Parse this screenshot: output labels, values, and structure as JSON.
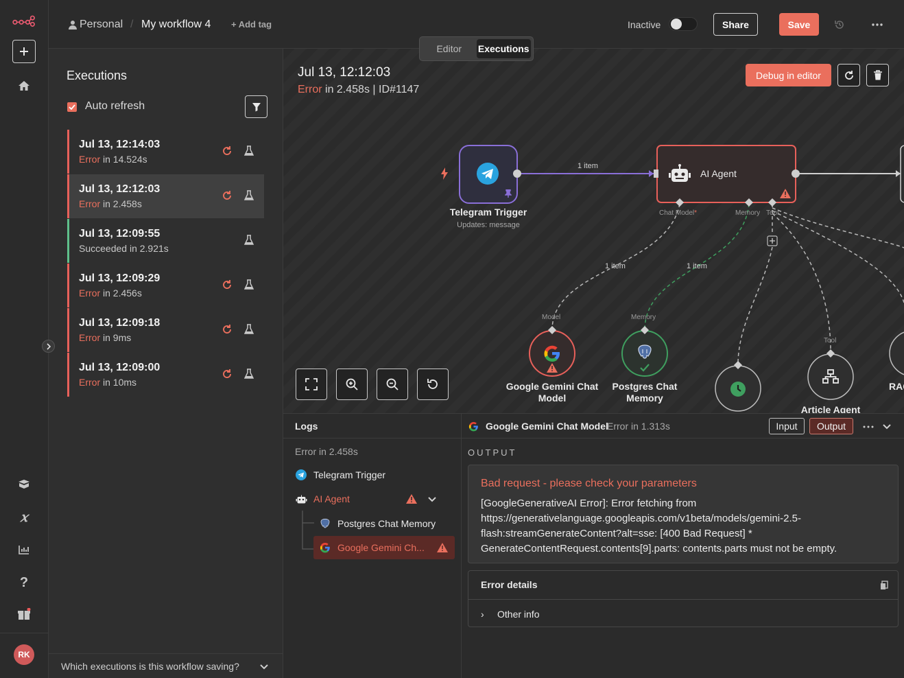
{
  "header": {
    "project": "Personal",
    "workflow_name": "My workflow 4",
    "add_tag": "+ Add tag",
    "active_label": "Inactive",
    "share": "Share",
    "save": "Save"
  },
  "mode_switch": {
    "editor": "Editor",
    "executions": "Executions"
  },
  "sidebar": {
    "avatar_initials": "RK"
  },
  "executions": {
    "title": "Executions",
    "auto_refresh": "Auto refresh",
    "items": [
      {
        "time": "Jul 13, 12:14:03",
        "status": "Error",
        "detail": " in 14.524s",
        "retry": true
      },
      {
        "time": "Jul 13, 12:12:03",
        "status": "Error",
        "detail": " in 2.458s",
        "retry": true
      },
      {
        "time": "Jul 13, 12:09:55",
        "status": "Succeeded",
        "detail": " in 2.921s",
        "retry": false
      },
      {
        "time": "Jul 13, 12:09:29",
        "status": "Error",
        "detail": " in 2.456s",
        "retry": true
      },
      {
        "time": "Jul 13, 12:09:18",
        "status": "Error",
        "detail": " in 9ms",
        "retry": true
      },
      {
        "time": "Jul 13, 12:09:00",
        "status": "Error",
        "detail": " in 10ms",
        "retry": true
      }
    ],
    "saving_question": "Which executions is this workflow saving?"
  },
  "canvas": {
    "run_time": "Jul 13, 12:12:03",
    "run_status": "Error",
    "run_detail": " in 2.458s",
    "run_id": "ID#1147",
    "debug": "Debug in editor",
    "nodes": {
      "telegram": {
        "name": "Telegram Trigger",
        "sub": "Updates: message"
      },
      "agent": {
        "name": "AI Agent"
      },
      "gemini": {
        "name": "Google Gemini Chat Model"
      },
      "postgres": {
        "name": "Postgres Chat Memory"
      },
      "article": {
        "name": "Article Agent"
      },
      "rag": {
        "name": "RAG"
      }
    },
    "ports": {
      "chat_model": "Chat Model",
      "required_mark": "*",
      "memory": "Memory",
      "tool": "Tool",
      "model": "Model",
      "memory_in": "Memory",
      "tool_in": "Tool"
    },
    "edge_labels": {
      "main": "1 item",
      "model": "1 item",
      "memory": "1 item"
    }
  },
  "logs": {
    "title": "Logs",
    "summary": "Error in 2.458s",
    "rows": {
      "telegram": "Telegram Trigger",
      "agent": "AI Agent",
      "postgres": "Postgres Chat Memory",
      "gemini": "Google Gemini Ch..."
    }
  },
  "output": {
    "node_name": "Google Gemini Chat Model",
    "node_status": "Error in 1.313s",
    "input_btn": "Input",
    "output_btn": "Output",
    "section": "OUTPUT",
    "error_title": "Bad request - please check your parameters",
    "error_message": "[GoogleGenerativeAI Error]: Error fetching from https://generativelanguage.googleapis.com/v1beta/models/gemini-2.5-flash:streamGenerateContent?alt=sse: [400 Bad Request] * GenerateContentRequest.contents[9].parts: contents.parts must not be empty.",
    "details_title": "Error details",
    "other_info": "Other info"
  },
  "colors": {
    "accent": "#ea6f5d",
    "success": "#5fbf8a",
    "error": "#ea6f5d",
    "telegram": "#2aa3df"
  },
  "icons": [
    "n8n-logo-icon",
    "plus-icon",
    "home-icon",
    "templates-icon",
    "variables-icon",
    "insights-icon",
    "help-icon",
    "gift-icon",
    "user-icon",
    "history-icon",
    "more-icon",
    "filter-icon",
    "retry-icon",
    "flask-icon",
    "refresh-icon",
    "trash-icon",
    "fit-view-icon",
    "zoom-in-icon",
    "zoom-out-icon",
    "reset-zoom-icon",
    "telegram-icon",
    "robot-icon",
    "google-icon",
    "postgres-icon",
    "clock-icon",
    "network-icon",
    "warning-icon",
    "chevron-down-icon",
    "copy-icon"
  ]
}
